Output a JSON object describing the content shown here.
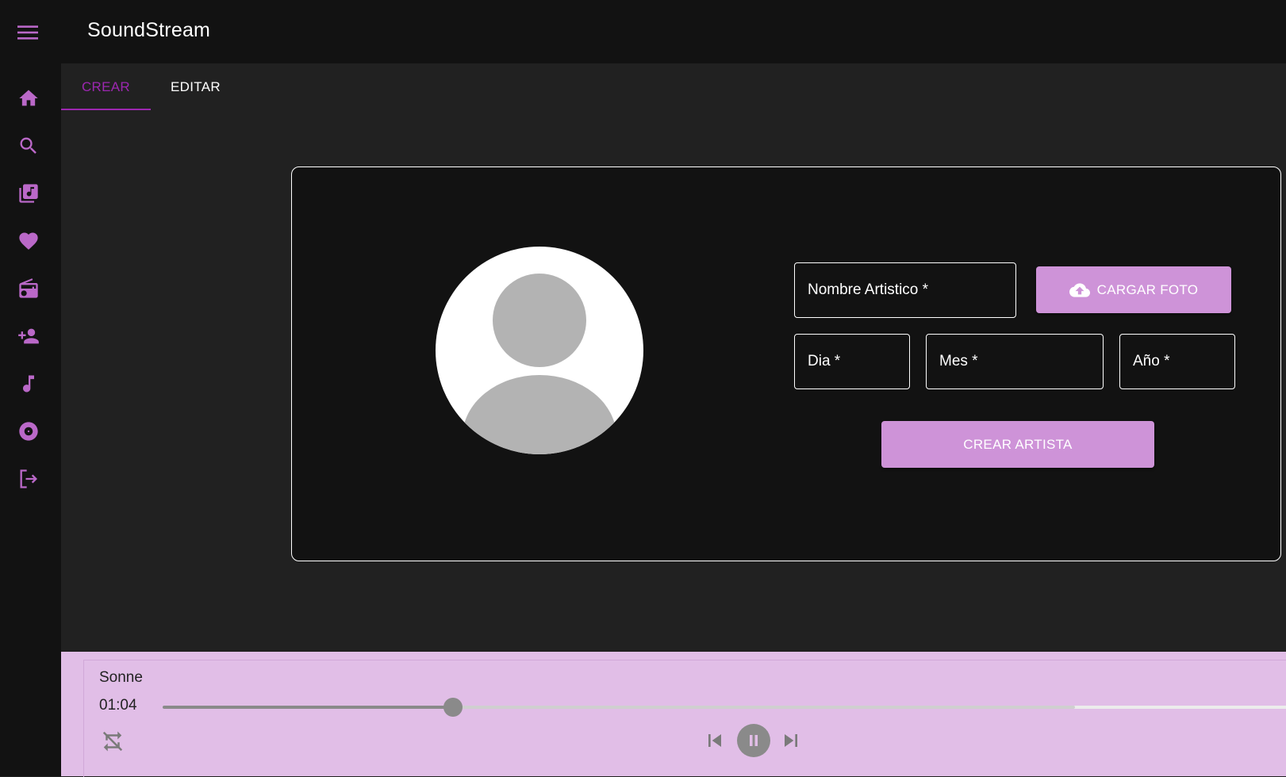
{
  "app": {
    "title": "SoundStream"
  },
  "icons": {
    "menu": "menu-icon",
    "sidebar": [
      "home-icon",
      "search-icon",
      "library-music-icon",
      "favorite-icon",
      "radio-icon",
      "person-add-icon",
      "music-note-icon",
      "album-icon",
      "logout-icon"
    ],
    "upload": "cloud-upload-icon",
    "repeat": "repeat-off-icon",
    "prev": "skip-previous-icon",
    "pause": "pause-icon",
    "next": "skip-next-icon"
  },
  "colors": {
    "accent": "#9c27b0",
    "accent_light": "#ce93d8",
    "player_bg": "#e1bee7",
    "appbar_bg": "#121212",
    "page_bg": "#212121"
  },
  "tabs": [
    {
      "label": "CREAR",
      "active": true
    },
    {
      "label": "EDITAR",
      "active": false
    }
  ],
  "form": {
    "artist_name": {
      "label": "Nombre Artistico *",
      "value": ""
    },
    "upload_button": "CARGAR FOTO",
    "day": {
      "label": "Dia *",
      "value": ""
    },
    "month": {
      "label": "Mes *",
      "value": ""
    },
    "year": {
      "label": "Año *",
      "value": ""
    },
    "submit_button": "CREAR ARTISTA"
  },
  "player": {
    "track_title": "Sonne",
    "current_time": "01:04",
    "progress": 0.258,
    "buffered": 0.81
  }
}
